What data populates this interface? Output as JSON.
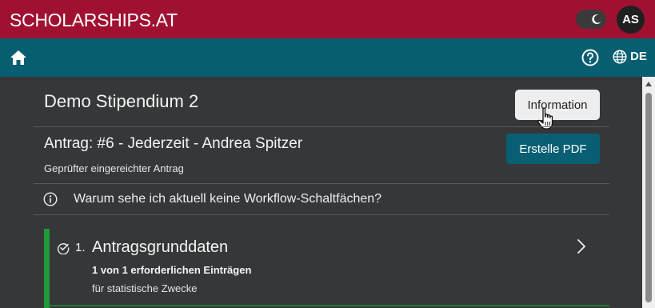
{
  "header": {
    "brand": "SCHOLARSHIPS.AT",
    "avatar_initials": "AS",
    "theme_toggle_icon": "moon-icon",
    "background": "#a01131"
  },
  "nav": {
    "home_icon": "home-icon",
    "help_icon": "help-icon",
    "globe_icon": "globe-icon",
    "language": "DE",
    "background": "#075e70"
  },
  "main": {
    "title": "Demo Stipendium 2",
    "information_button": "Information",
    "antrag_title": "Antrag: #6 - Jederzeit - Andrea Spitzer",
    "antrag_status": "Geprüfter eingereichter Antrag",
    "create_pdf_button": "Erstelle PDF",
    "workflow_question": "Warum sehe ich aktuell keine Workflow-Schaltfächen?"
  },
  "sections": [
    {
      "number": "1.",
      "title": "Antragsgrunddaten",
      "count": "1 von 1 erforderlichen Einträgen",
      "description": "für statistische Zwecke",
      "accent": "#1f9a3a"
    }
  ]
}
